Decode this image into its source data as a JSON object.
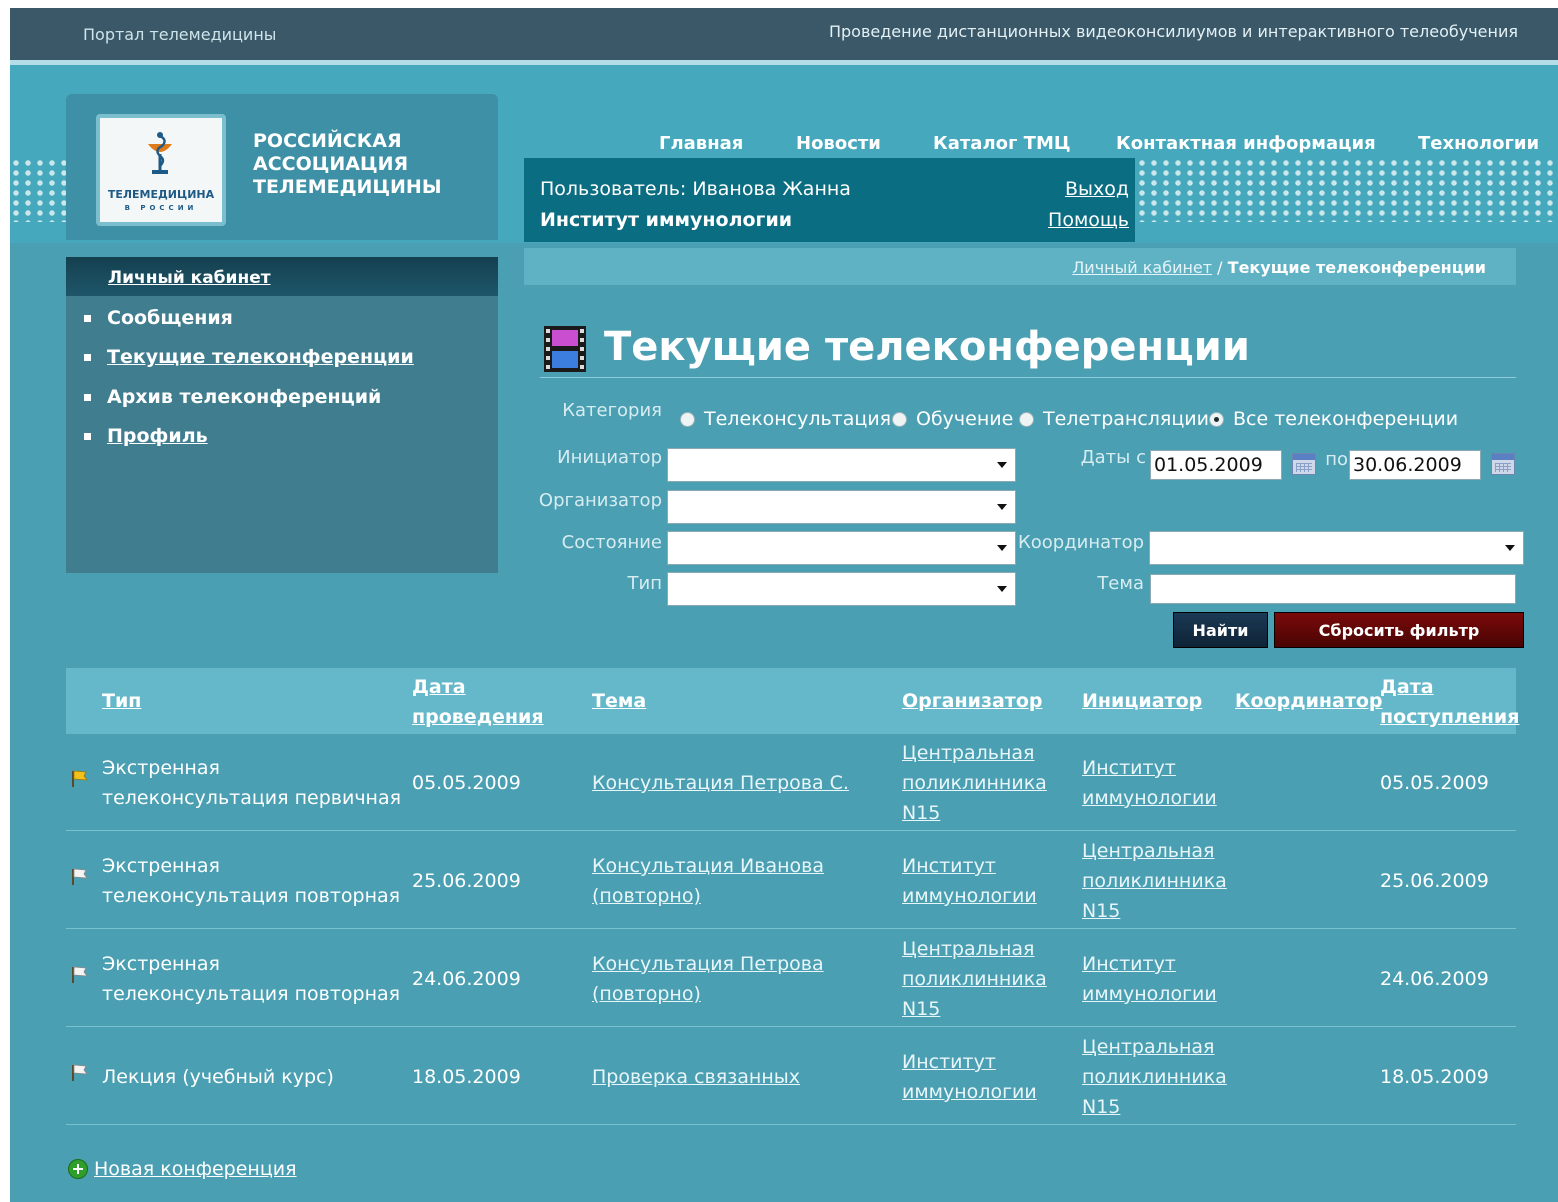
{
  "topbar": {
    "portal_title": "Портал телемедицины",
    "tagline": "Проведение дистанционных видеоконсилиумов и интерактивного телеобучения"
  },
  "nav": {
    "items": [
      "Главная",
      "Новости",
      "Каталог ТМЦ",
      "Контактная информация",
      "Технологии"
    ]
  },
  "logo": {
    "text1": "ТЕЛЕМЕДИЦИНА",
    "text2": "В РОССИИ",
    "association": "Российская ассоциация телемедицины"
  },
  "user": {
    "name": "Пользователь: Иванова Жанна",
    "org": "Институт иммунологии",
    "logout": "Выход",
    "help": "Помощь"
  },
  "sidebar": {
    "title": "Личный кабинет",
    "items": [
      {
        "label": "Сообщения",
        "link": false
      },
      {
        "label": "Текущие телеконференции",
        "link": true
      },
      {
        "label": "Архив телеконференций",
        "link": false
      },
      {
        "label": "Профиль",
        "link": true
      }
    ]
  },
  "breadcrumb": {
    "link": "Личный кабинет",
    "separator": " / ",
    "current": "Текущие телеконференции"
  },
  "page": {
    "title": "Текущие телеконференции",
    "icon": "film-icon"
  },
  "filter": {
    "category_label": "Категория",
    "categories": [
      {
        "label": "Телеконсультация",
        "checked": false
      },
      {
        "label": "Обучение",
        "checked": false
      },
      {
        "label": "Телетрансляции",
        "checked": false
      },
      {
        "label": "Все телеконференции",
        "checked": true
      }
    ],
    "initiator_label": "Инициатор",
    "initiator_value": "",
    "organizer_label": "Организатор",
    "organizer_value": "",
    "state_label": "Состояние",
    "state_value": "",
    "type_label": "Тип",
    "type_value": "",
    "coordinator_label": "Координатор",
    "coordinator_value": "",
    "topic_label": "Тема",
    "topic_value": "",
    "dates_label": "Даты с",
    "date_from": "01.05.2009",
    "to_label": "по",
    "date_to": "30.06.2009",
    "find_button": "Найти",
    "reset_button": "Сбросить фильтр"
  },
  "table": {
    "headers": [
      "Тип",
      "Дата проведения",
      "Тема",
      "Организатор",
      "Инициатор",
      "Координатор",
      "Дата поступления"
    ],
    "rows": [
      {
        "flag": "yellow",
        "type": "Экстренная телеконсультация первичная",
        "date": "05.05.2009",
        "topic": "Консультация Петрова С.",
        "organizer": "Центральная поликлинника N15",
        "initiator": "Институт иммунологии",
        "coordinator": "",
        "received": "05.05.2009"
      },
      {
        "flag": "white",
        "type": "Экстренная телеконсультация повторная",
        "date": "25.06.2009",
        "topic": "Консультация Иванова (повторно)",
        "organizer": "Институт иммунологии",
        "initiator": "Центральная поликлинника N15",
        "coordinator": "",
        "received": "25.06.2009"
      },
      {
        "flag": "white",
        "type": "Экстренная телеконсультация повторная",
        "date": "24.06.2009",
        "topic": "Консультация Петрова (повторно)",
        "organizer": "Центральная поликлинника N15",
        "initiator": "Институт иммунологии",
        "coordinator": "",
        "received": "24.06.2009"
      },
      {
        "flag": "white",
        "type": "Лекция (учебный курс)",
        "date": "18.05.2009",
        "topic": "Проверка связанных",
        "organizer": "Институт иммунологии",
        "initiator": "Центральная поликлинника N15",
        "coordinator": "",
        "received": "18.05.2009"
      }
    ]
  },
  "footer": {
    "new_conference": "Новая конференция"
  }
}
